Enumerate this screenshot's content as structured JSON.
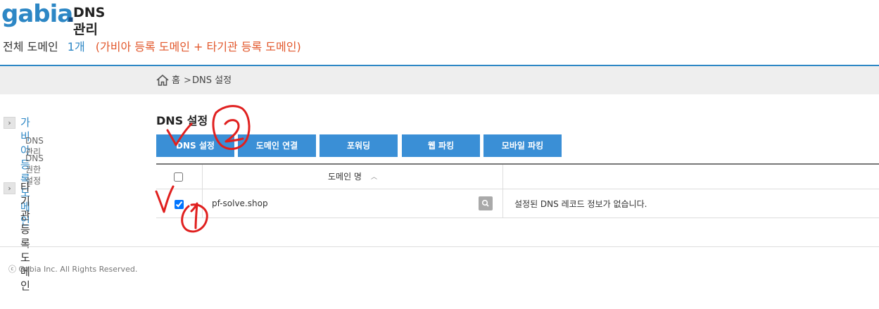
{
  "header": {
    "logo": "gabia",
    "title": "DNS 관리"
  },
  "summary": {
    "label": "전체 도메인",
    "count": "1개",
    "note": "(가비아 등록 도메인 + 타기관 등록 도메인)"
  },
  "breadcrumb": {
    "home": "홈",
    "separator": ">",
    "current": "DNS 설정"
  },
  "sidebar": {
    "items": [
      {
        "label": "가비아 등록 도메인",
        "active": true,
        "children": [
          "DNS 관리",
          "DNS 권한 설정"
        ]
      },
      {
        "label": "타기관 등록 도메인",
        "active": false,
        "children": []
      }
    ]
  },
  "main": {
    "title": "DNS 설정",
    "tabs": [
      "DNS 설정",
      "도메인 연결",
      "포워딩",
      "웹 파킹",
      "모바일 파킹"
    ],
    "table": {
      "header_domain": "도메인 명",
      "header_checked": false,
      "rows": [
        {
          "checked": true,
          "domain": "pf-solve.shop",
          "status": "설정된 DNS 레코드 정보가 없습니다."
        }
      ]
    }
  },
  "footer": {
    "copyright": "ⓒ Gabia Inc. All Rights Reserved."
  },
  "icons": {
    "home": "home-icon",
    "sort": "sort-asc-icon",
    "search": "search-icon",
    "chevron": "chevron-right-icon"
  },
  "colors": {
    "brand": "#2d87c5",
    "button": "#3a8fd6",
    "note": "#e2572b",
    "annotation": "#e0201f"
  }
}
